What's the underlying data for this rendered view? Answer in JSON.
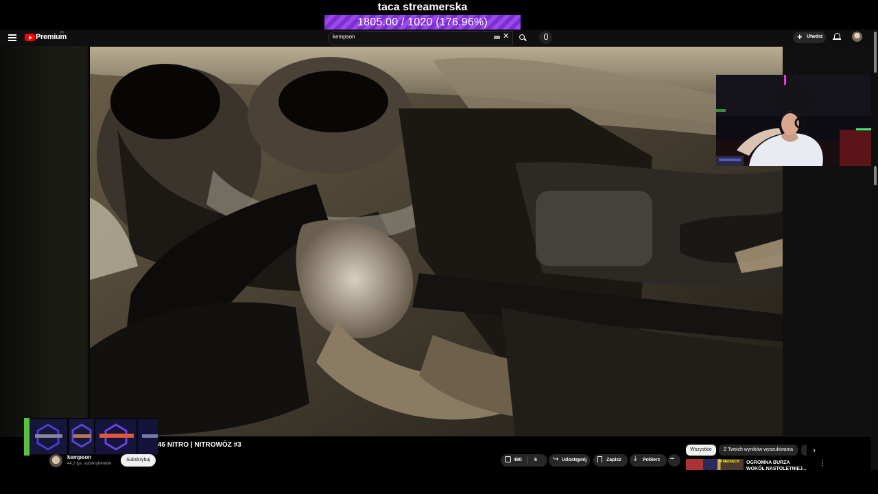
{
  "stream_overlay": {
    "goal_title": "taca streamerska",
    "goal_progress_text": "1805.00 / 1020 (176.96%)",
    "goal_progress_fraction": 1.7696,
    "bar_color": "#8a3fe0"
  },
  "header": {
    "logo_text": "Premium",
    "logo_country": "PL",
    "search_value": "kempson",
    "create_label": "Utwórz"
  },
  "video": {
    "title": "46 NITRO | NITROWÓZ #3",
    "channel_name": "kempson",
    "subscribers": "44,2 tys. subskrybentów",
    "subscribe_label": "Subskrybuj",
    "likes": "480",
    "dislikes": "6",
    "share_label": "Udostępnij",
    "save_label": "Zapisz",
    "download_label": "Pobierz",
    "more_label": "•••"
  },
  "recommendations": {
    "chips": [
      "Wszystkie",
      "Z Twoich wyników wyszukiwania"
    ],
    "first_title": "OGROMNA BURZA WOKÓŁ NASTOLETNIEJ...",
    "thumb_text": "W MEDIACH"
  },
  "colors": {
    "yt_red": "#ff0000",
    "bg": "#0f0f0f",
    "pill": "#272727"
  }
}
